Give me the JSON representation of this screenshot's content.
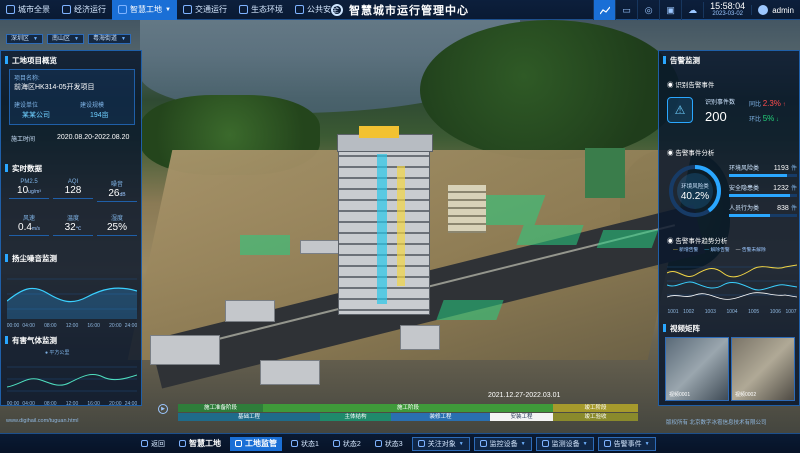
{
  "topbar": {
    "nav": [
      {
        "label": "城市全景",
        "icon": "globe-icon"
      },
      {
        "label": "经济运行",
        "icon": "chart-icon"
      },
      {
        "label": "智慧工地",
        "icon": "building-icon",
        "active": true
      },
      {
        "label": "交通运行",
        "icon": "car-icon"
      },
      {
        "label": "生态环境",
        "icon": "leaf-icon"
      },
      {
        "label": "公共安全",
        "icon": "shield-icon"
      }
    ],
    "title": "智慧城市运行管理中心",
    "time": "15:58:04",
    "date": "2023-03-02",
    "user": "admin"
  },
  "filters": {
    "district": "深圳区",
    "subdistrict": "南山区",
    "area": "粤海街道"
  },
  "left": {
    "overview_title": "工地项目概览",
    "project_name_label": "项目名称:",
    "project_name": "前海区HK314-05开发项目",
    "builder_label": "建设单位",
    "builder": "某某公司",
    "scale_label": "建设规模",
    "scale": "194亩",
    "period_label": "施工时间",
    "period": "2020.08.20-2022.08.20",
    "realtime_title": "实时数据",
    "metrics": [
      {
        "label": "PM2.5",
        "value": "10",
        "unit": "ug/m³"
      },
      {
        "label": "AQI",
        "value": "128",
        "unit": ""
      },
      {
        "label": "噪音",
        "value": "26",
        "unit": "dB"
      },
      {
        "label": "风速",
        "value": "0.4",
        "unit": "m/s"
      },
      {
        "label": "温度",
        "value": "32",
        "unit": "℃"
      },
      {
        "label": "湿度",
        "value": "25%",
        "unit": ""
      }
    ],
    "dust_title": "扬尘噪音监测",
    "dust_ticks": [
      "00:00",
      "04:00",
      "08:00",
      "12:00",
      "16:00",
      "20:00",
      "24:00"
    ],
    "gas_title": "有害气体监测",
    "gas_legend": "平方公里",
    "gas_ticks": [
      "00:00",
      "04:00",
      "08:00",
      "12:00",
      "16:00",
      "20:00",
      "24:00"
    ]
  },
  "right": {
    "title": "告警监测",
    "identify_title": "识别告警事件",
    "identify_count_label": "识别事件数",
    "identify_count": "200",
    "identify_same_label": "同比",
    "identify_same": "2.3%",
    "identify_chain_label": "环比",
    "identify_chain": "5%",
    "type_title": "告警事件分析",
    "type_ring_label": "环境风险类",
    "type_ring_value": "40.2%",
    "types": [
      {
        "label": "环境风险类",
        "value": "1193",
        "unit": "件"
      },
      {
        "label": "安全隐患类",
        "value": "1232",
        "unit": "件"
      },
      {
        "label": "人员行为类",
        "value": "838",
        "unit": "件"
      }
    ],
    "trend_title": "告警事件趋势分析",
    "trend_legend": [
      "新增告警",
      "解除告警",
      "告警未解除"
    ],
    "trend_ticks": [
      "1001",
      "1002",
      "1003",
      "1004",
      "1005",
      "1006",
      "1007"
    ],
    "video_title": "视频矩阵",
    "video_labels": [
      "视频0001",
      "视频0002"
    ]
  },
  "timeline": {
    "date": "2021.12.27-2022.03.01",
    "stages_top": [
      "施工准备阶段",
      "施工阶段",
      "竣工阶段"
    ],
    "stages_bottom": [
      "基础工程",
      "主体结构",
      "装修工程",
      "安装工程",
      "竣工验收"
    ],
    "copyright": "版权所有 北京数字冰雹信息技术有限公司",
    "url": "www.digihail.com/tuguan.html"
  },
  "bottombar": {
    "back": "返回",
    "site": "智慧工地",
    "monitor": "工地监管",
    "states": [
      "状态1",
      "状态2",
      "状态3"
    ],
    "dropdowns": [
      "关注对象",
      "监控设备",
      "监测设备",
      "告警事件"
    ]
  },
  "colors": {
    "accent": "#1a6fd6",
    "panel": "#081628",
    "green": "#24d07a",
    "red": "#ff4d4d"
  }
}
